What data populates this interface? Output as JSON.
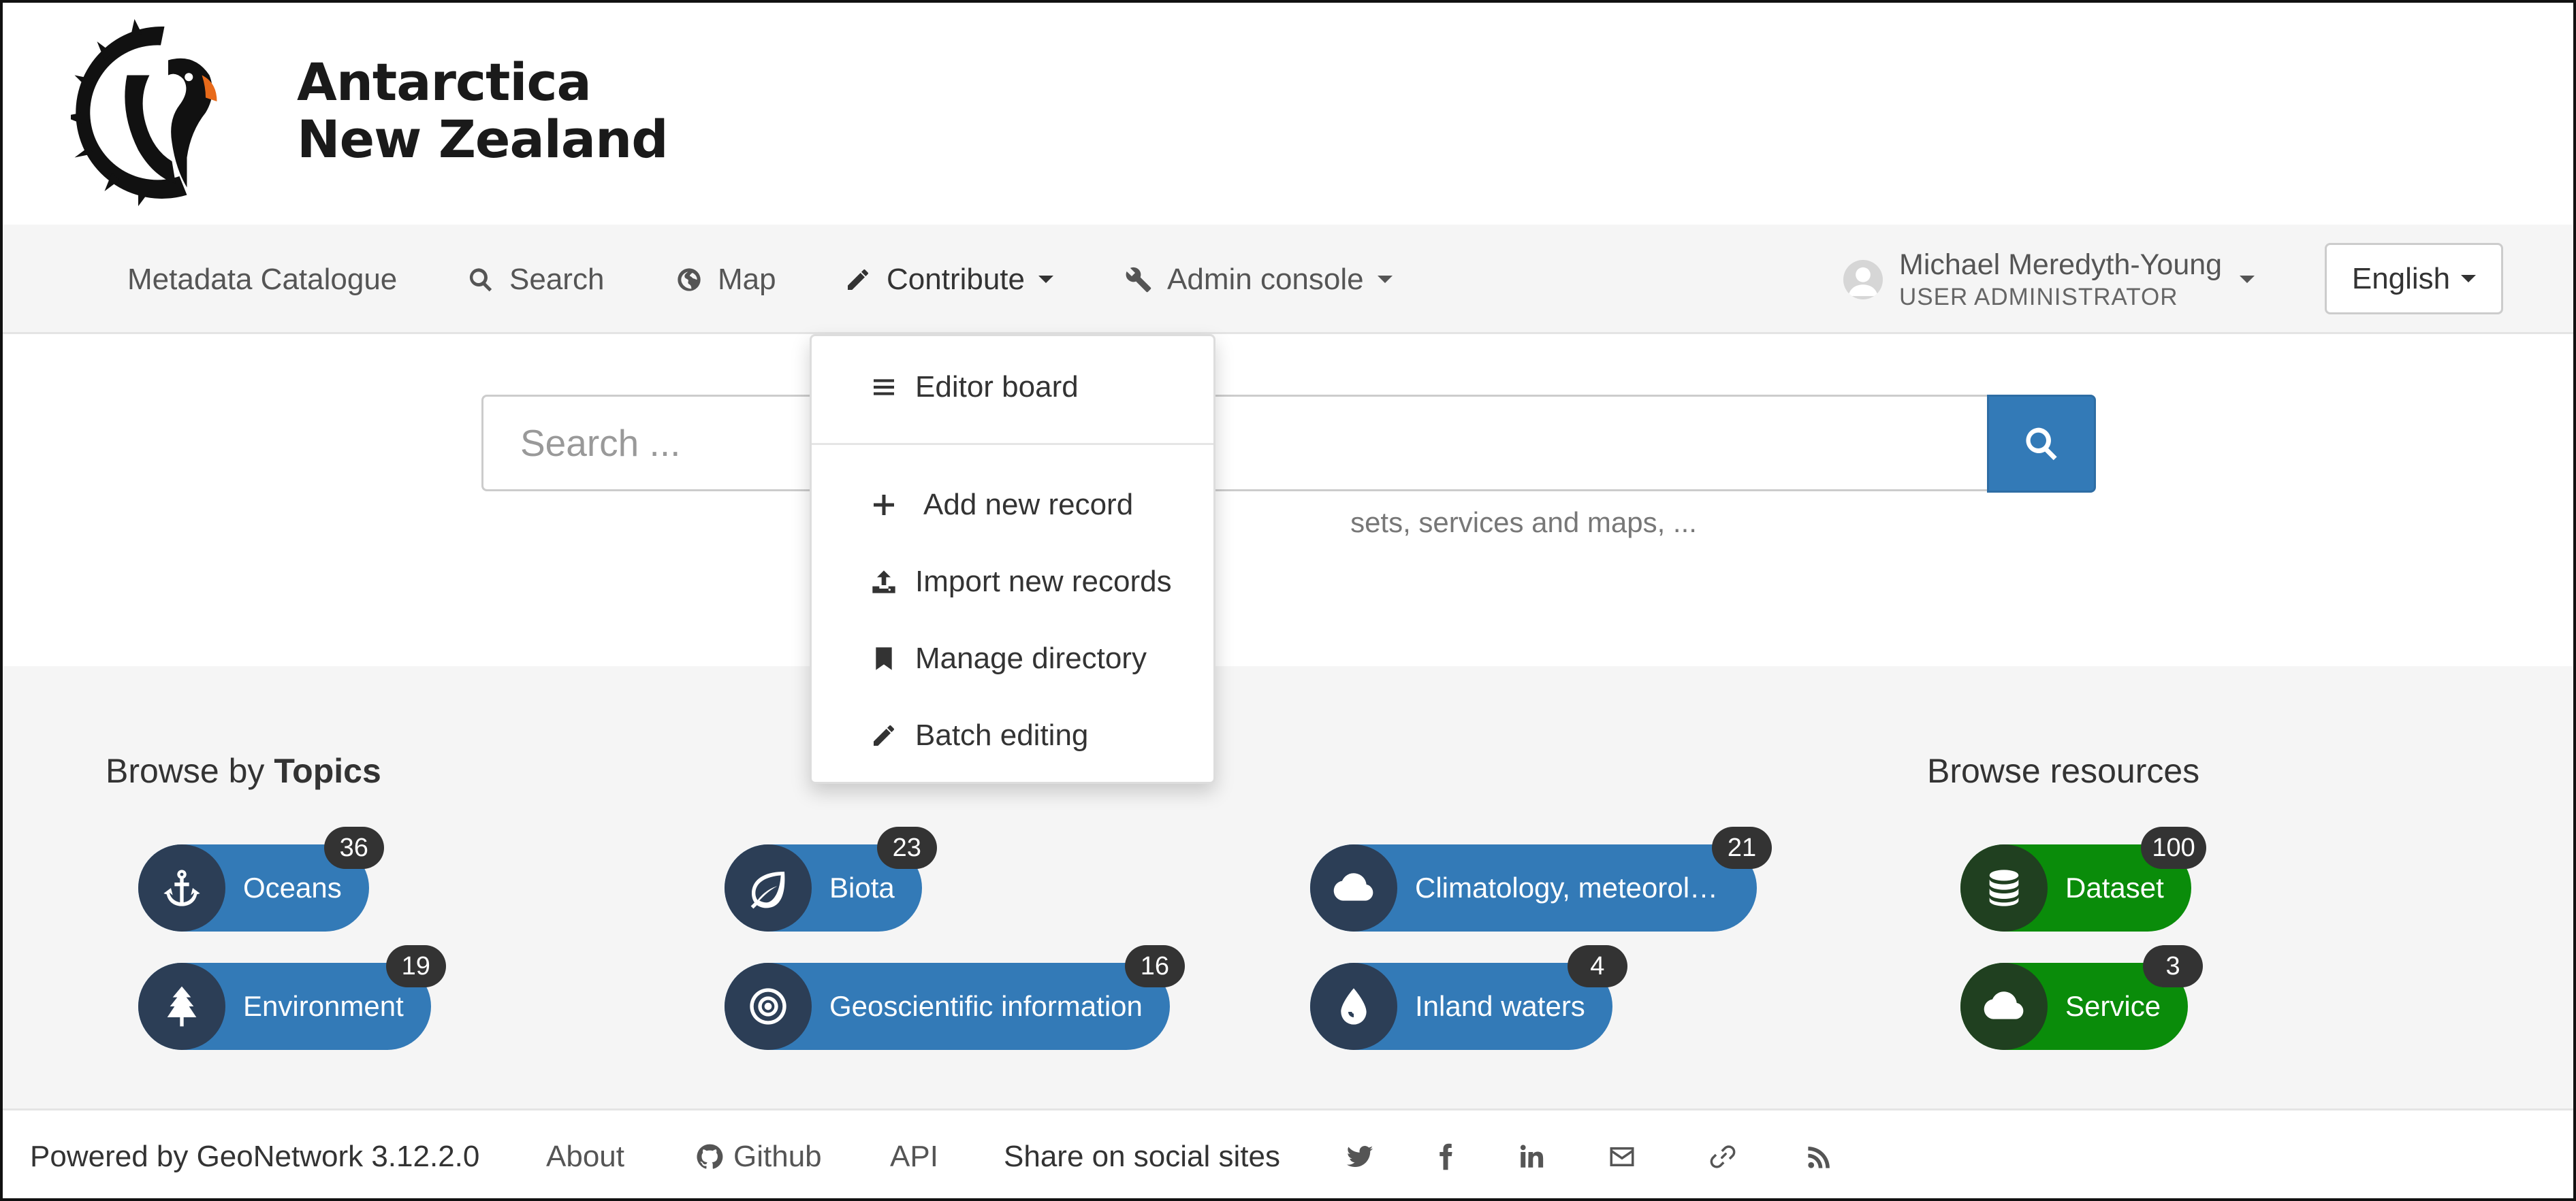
{
  "brand": {
    "line1": "Antarctica",
    "line2": "New Zealand"
  },
  "nav": {
    "catalogue": "Metadata Catalogue",
    "search": "Search",
    "map": "Map",
    "contribute": "Contribute",
    "admin": "Admin console"
  },
  "user": {
    "name": "Michael Meredyth-Young",
    "role": "USER ADMINISTRATOR"
  },
  "language": "English",
  "search": {
    "placeholder": "Search ...",
    "hint": "sets, services and maps, ..."
  },
  "contribute_menu": {
    "editor_board": "Editor board",
    "add_record": "Add new record",
    "import_records": "Import new records",
    "manage_directory": "Manage directory",
    "batch_editing": "Batch editing"
  },
  "topics": {
    "heading_prefix": "Browse by",
    "heading_bold": "Topics",
    "items": [
      {
        "label": "Oceans",
        "count": "36",
        "icon": "anchor-icon"
      },
      {
        "label": "Biota",
        "count": "23",
        "icon": "leaf-icon"
      },
      {
        "label": "Climatology, meteorolo…",
        "count": "21",
        "icon": "cloud-icon"
      },
      {
        "label": "Environment",
        "count": "19",
        "icon": "tree-icon"
      },
      {
        "label": "Geoscientific information",
        "count": "16",
        "icon": "target-icon"
      },
      {
        "label": "Inland waters",
        "count": "4",
        "icon": "droplet-icon"
      }
    ]
  },
  "resources": {
    "heading": "Browse resources",
    "items": [
      {
        "label": "Dataset",
        "count": "100",
        "icon": "database-icon"
      },
      {
        "label": "Service",
        "count": "3",
        "icon": "cloud-icon"
      }
    ]
  },
  "footer": {
    "powered": "Powered by GeoNetwork 3.12.2.0",
    "about": "About",
    "github": "Github",
    "api": "API",
    "share": "Share on social sites"
  },
  "colors": {
    "primary": "#337ab7",
    "resource_green": "#0a8c0a",
    "badge": "#333333",
    "nav_bg": "#f5f5f5"
  }
}
